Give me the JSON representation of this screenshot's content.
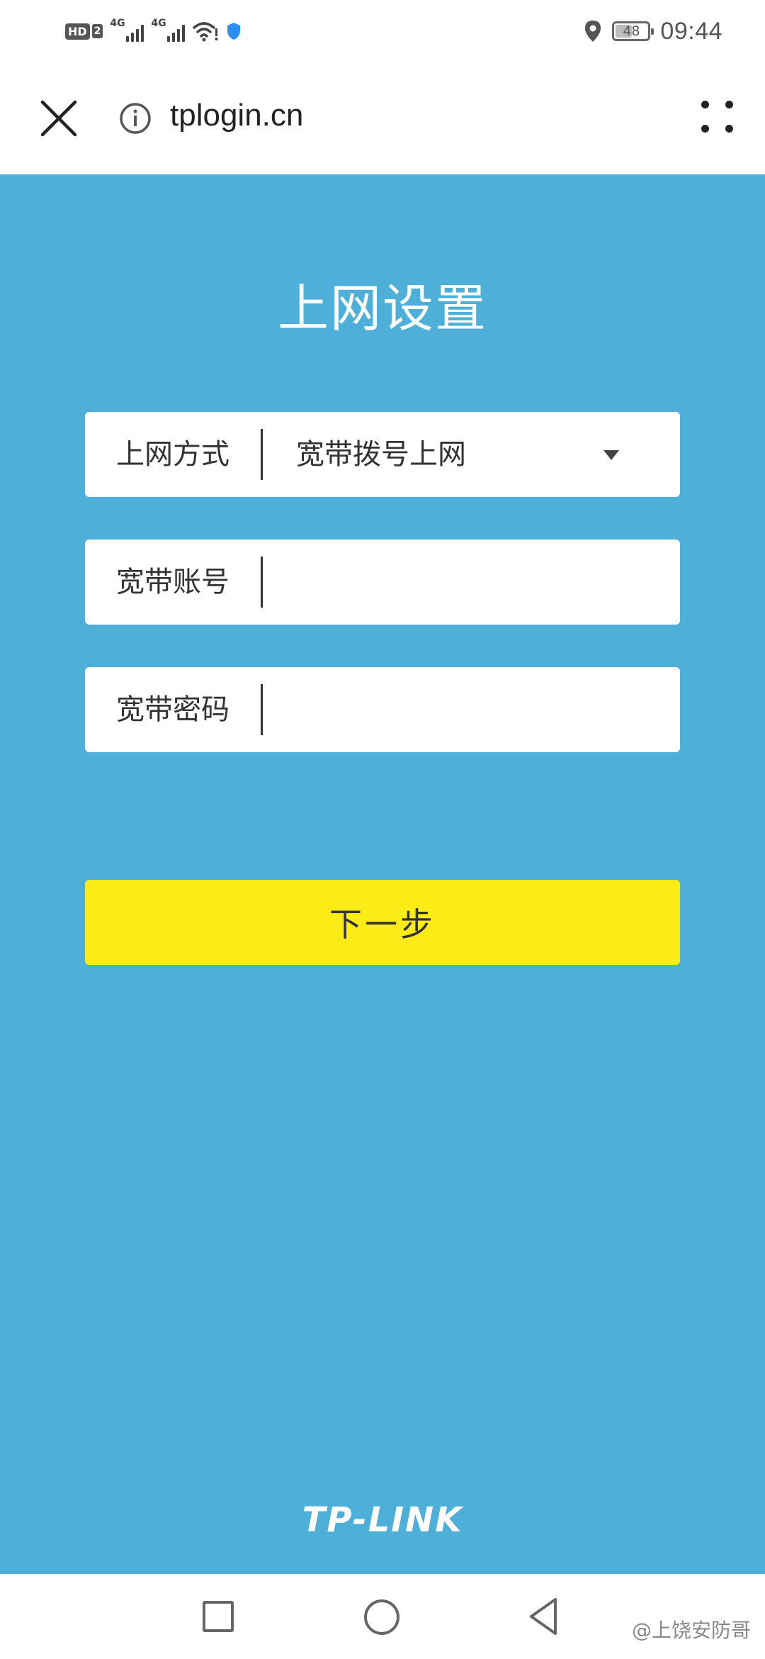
{
  "status_bar": {
    "hd_label": "HD",
    "sim_label": "2",
    "signal_1": "4G",
    "signal_2": "4G",
    "battery": "48",
    "time": "09:44"
  },
  "browser": {
    "url": "tplogin.cn"
  },
  "page": {
    "title": "上网设置",
    "fields": [
      {
        "label": "上网方式",
        "value": "宽带拨号上网"
      },
      {
        "label": "宽带账号",
        "value": ""
      },
      {
        "label": "宽带密码",
        "value": ""
      }
    ],
    "next_label": "下一步",
    "brand": "TP-LINK"
  },
  "watermark": "@上饶安防哥",
  "colors": {
    "page_background": "#4eafd8",
    "button_background": "#fbeb17",
    "field_background": "#ffffff"
  },
  "icons": {
    "close": "close-icon",
    "info": "info-icon",
    "menu": "menu-dots-icon",
    "dropdown": "triangle-down-icon"
  }
}
